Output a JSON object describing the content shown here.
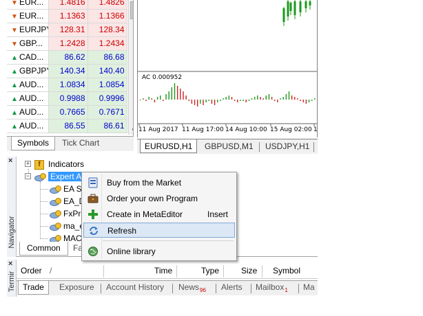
{
  "market_watch": {
    "rows": [
      {
        "symbol": "EUR...",
        "bid": "1.4816",
        "ask": "1.4826",
        "dir": "down"
      },
      {
        "symbol": "EUR...",
        "bid": "1.1363",
        "ask": "1.1366",
        "dir": "down"
      },
      {
        "symbol": "EURJPY",
        "bid": "128.31",
        "ask": "128.34",
        "dir": "down"
      },
      {
        "symbol": "GBP...",
        "bid": "1.2428",
        "ask": "1.2434",
        "dir": "down"
      },
      {
        "symbol": "CAD...",
        "bid": "86.62",
        "ask": "86.68",
        "dir": "up"
      },
      {
        "symbol": "GBPJPY",
        "bid": "140.34",
        "ask": "140.40",
        "dir": "up"
      },
      {
        "symbol": "AUD...",
        "bid": "1.0834",
        "ask": "1.0854",
        "dir": "up"
      },
      {
        "symbol": "AUD...",
        "bid": "0.9988",
        "ask": "0.9996",
        "dir": "up"
      },
      {
        "symbol": "AUD...",
        "bid": "0.7665",
        "ask": "0.7671",
        "dir": "up"
      },
      {
        "symbol": "AUD...",
        "bid": "86.55",
        "ask": "86.61",
        "dir": "up"
      }
    ],
    "tabs": [
      "Symbols",
      "Tick Chart"
    ]
  },
  "chart": {
    "indicator_label": "AC 0.000952",
    "dates": [
      "11 Aug 2017",
      "11 Aug 17:00",
      "14 Aug 10:00",
      "15 Aug 02:00",
      "1"
    ],
    "tabs": [
      "EURUSD,H1",
      "GBPUSD,M1",
      "USDJPY,H1"
    ],
    "colors": {
      "up": "#1a9a1a",
      "down": "#cc2222"
    }
  },
  "navigator": {
    "side_label": "Navigator",
    "indicators": "Indicators",
    "expert_advisors": "Expert Ac",
    "experts": [
      "EA Sc",
      "EA_D",
      "FxPro",
      "ma_e",
      "MAC"
    ],
    "tabs": [
      "Common",
      "Fa"
    ]
  },
  "context_menu": {
    "items": [
      {
        "label": "Buy from the Market",
        "shortcut": "",
        "icon": "market-icon"
      },
      {
        "label": "Order your own Program",
        "shortcut": "",
        "icon": "briefcase-icon"
      },
      {
        "label": "Create in MetaEditor",
        "shortcut": "Insert",
        "icon": "plus-icon"
      },
      {
        "label": "Refresh",
        "shortcut": "",
        "icon": "refresh-icon"
      },
      {
        "label": "Online library",
        "shortcut": "",
        "icon": "globe-icon"
      }
    ]
  },
  "terminal": {
    "side_label": "Termir",
    "columns": [
      "Order",
      "/",
      "Time",
      "Type",
      "Size",
      "Symbol"
    ],
    "tabs": [
      {
        "label": "Trade",
        "badge": ""
      },
      {
        "label": "Exposure",
        "badge": ""
      },
      {
        "label": "Account History",
        "badge": ""
      },
      {
        "label": "News",
        "badge": "96"
      },
      {
        "label": "Alerts",
        "badge": ""
      },
      {
        "label": "Mailbox",
        "badge": "1"
      },
      {
        "label": "Ma",
        "badge": ""
      }
    ]
  }
}
